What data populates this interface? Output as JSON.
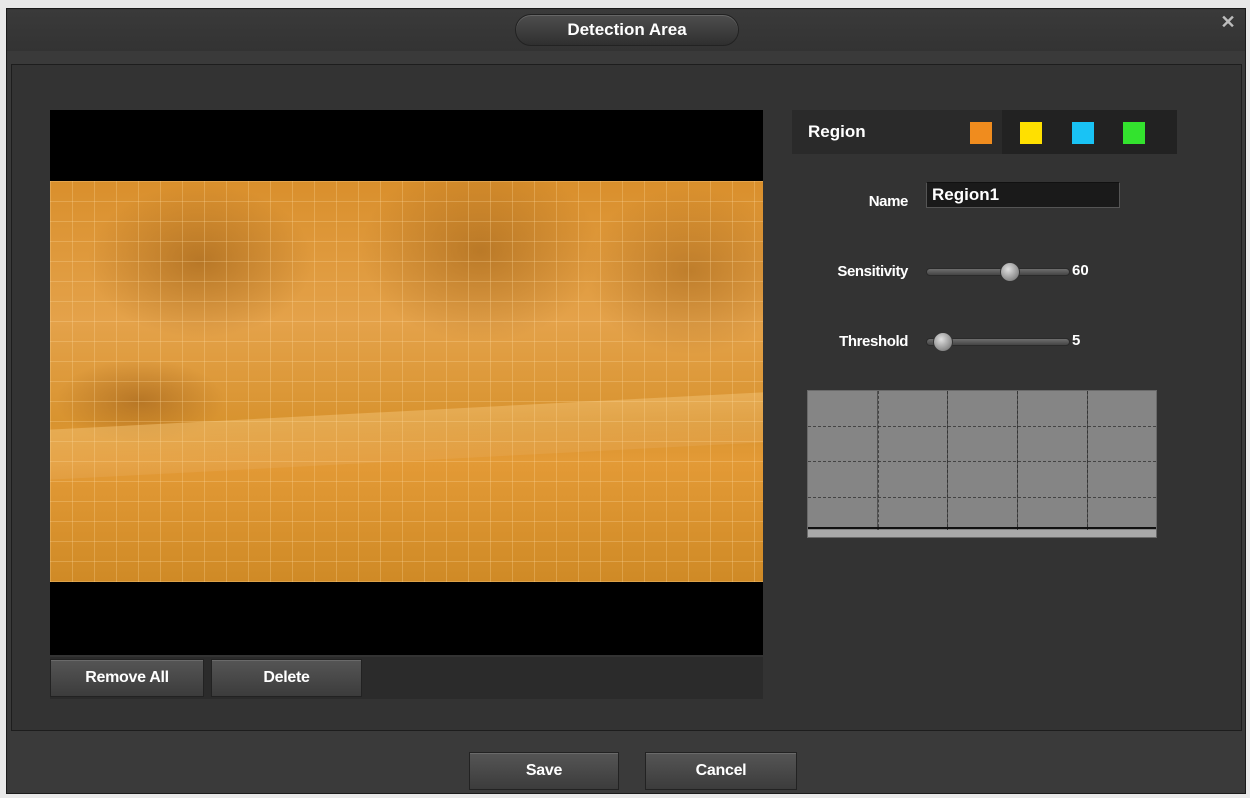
{
  "dialog": {
    "title": "Detection Area",
    "close_glyph": "✕"
  },
  "video": {
    "buttons": {
      "remove_all": "Remove All",
      "delete": "Delete"
    }
  },
  "region": {
    "label": "Region",
    "swatches": [
      {
        "name": "orange",
        "color": "#f08c1e",
        "selected": true
      },
      {
        "name": "yellow",
        "color": "#ffe000",
        "selected": false
      },
      {
        "name": "cyan",
        "color": "#19c3f5",
        "selected": false
      },
      {
        "name": "green",
        "color": "#33e32e",
        "selected": false
      }
    ],
    "name_label": "Name",
    "name_value": "Region1",
    "sensitivity_label": "Sensitivity",
    "sensitivity_value": "60",
    "sensitivity_fraction": 0.6,
    "threshold_label": "Threshold",
    "threshold_value": "5",
    "threshold_fraction": 0.05
  },
  "footer": {
    "save": "Save",
    "cancel": "Cancel"
  }
}
